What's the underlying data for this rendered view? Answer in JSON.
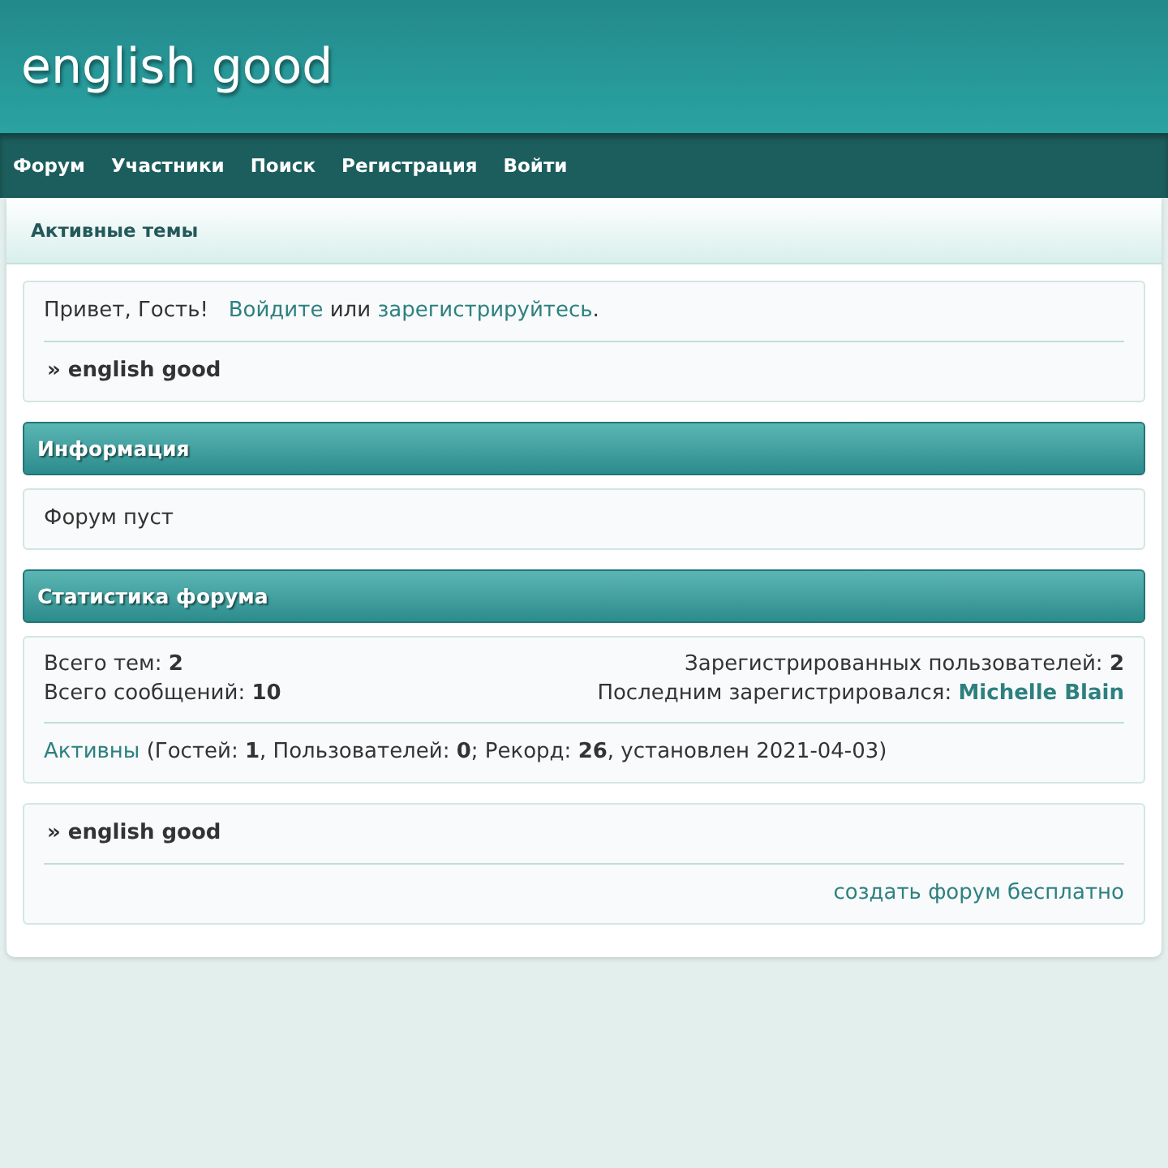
{
  "site_title": "english good",
  "nav": [
    "Форум",
    "Участники",
    "Поиск",
    "Регистрация",
    "Войти"
  ],
  "subnav": "Активные темы",
  "welcome": {
    "greeting": "Привет, Гость!",
    "login_link": "Войдите",
    "between": "или",
    "register_link": "зарегистрируйтесь",
    "end": ".",
    "crumb": "» english good"
  },
  "info": {
    "title": "Информация",
    "text": "Форум пуст"
  },
  "stats": {
    "title": "Статистика форума",
    "left": [
      "Всего тем: **2**",
      "Всего сообщений: **10**"
    ],
    "registered": "Зарегистрированных пользователей: **2**",
    "last_label": "Последним зарегистрировался:",
    "last_user": "Michelle Blain",
    "active_link": "Активны",
    "active_text": "(Гостей: **1**, Пользователей: **0**; Рекорд: **26**, установлен 2021-04-03)"
  },
  "footer": {
    "crumb": "» english good",
    "link": "создать форум бесплатно"
  }
}
